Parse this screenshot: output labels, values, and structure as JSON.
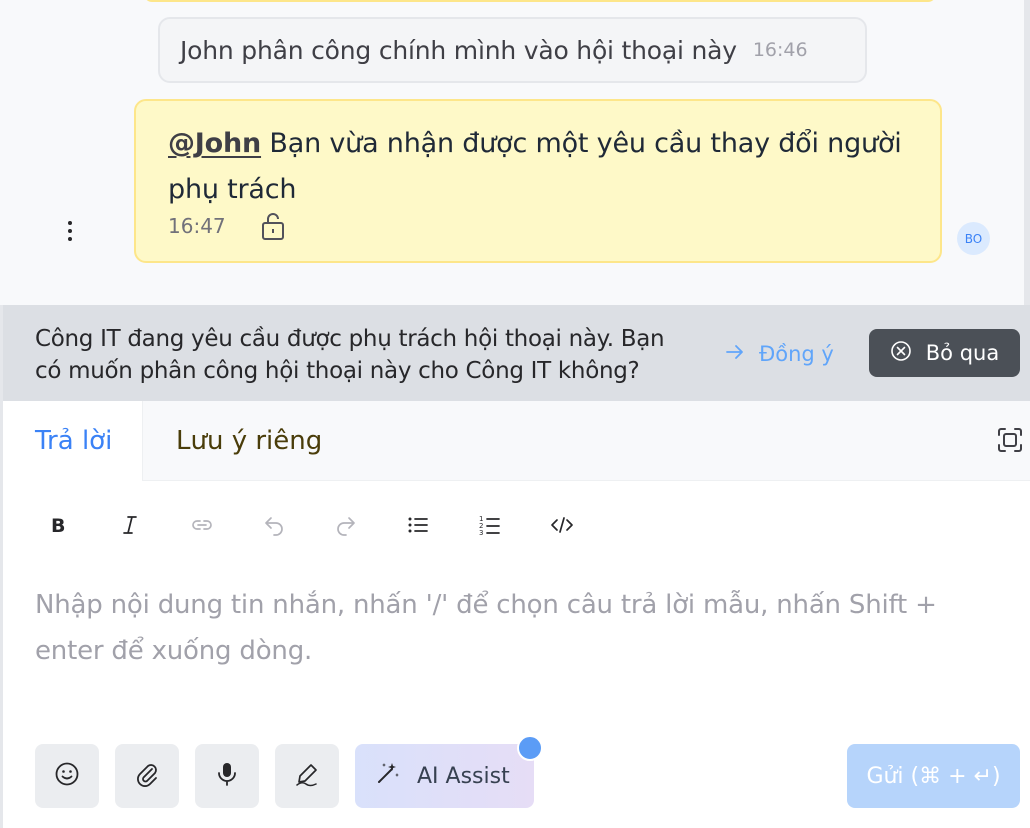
{
  "conversation": {
    "activity": {
      "text": "John phân công chính mình vào hội thoại này",
      "time": "16:46"
    },
    "private_note": {
      "mention": "@John",
      "text": " Bạn vừa nhận được một yêu cầu thay đổi người phụ trách",
      "time": "16:47",
      "icon": "lock-icon"
    },
    "avatar_initials": "BO"
  },
  "banner": {
    "text": "Công IT đang yêu cầu được phụ trách hội thoại này. Bạn có muốn phân công hội thoại này cho Công IT không?",
    "accept_label": "Đồng ý",
    "dismiss_label": "Bỏ qua"
  },
  "composer": {
    "tabs": [
      {
        "label": "Trả lời",
        "active": true
      },
      {
        "label": "Lưu ý riêng",
        "active": false
      }
    ],
    "toolbar": [
      "bold-icon",
      "italic-icon",
      "link-icon",
      "undo-icon",
      "redo-icon",
      "bullet-list-icon",
      "numbered-list-icon",
      "code-icon"
    ],
    "placeholder": "Nhập nội dung tin nhắn, nhấn '/' để chọn câu trả lời mẫu, nhấn Shift + enter để xuống dòng.",
    "actions": [
      "emoji-icon",
      "attachment-icon",
      "microphone-icon",
      "signature-icon"
    ],
    "ai_assist_label": "AI Assist",
    "send_label": "Gửi (⌘ + ↵)"
  },
  "colors": {
    "accent": "#3b82f6",
    "note_background": "#fef9c8",
    "banner_background": "#dcdfe4",
    "dismiss_button": "#4b5057",
    "send_disabled": "#b6d4fb"
  }
}
